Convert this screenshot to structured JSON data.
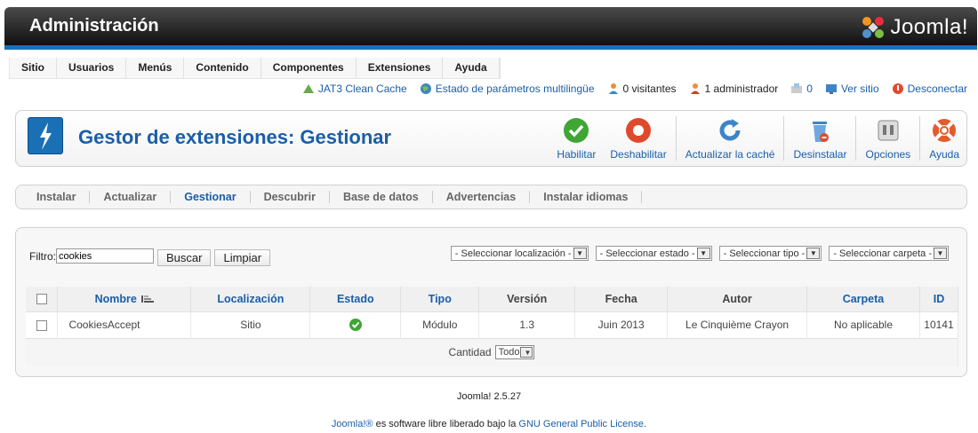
{
  "header": {
    "title": "Administración",
    "logo_text": "Joomla!"
  },
  "menu": [
    "Sitio",
    "Usuarios",
    "Menús",
    "Contenido",
    "Componentes",
    "Extensiones",
    "Ayuda"
  ],
  "status": {
    "cache": "JAT3 Clean Cache",
    "multilang": "Estado de parámetros multilingüe",
    "visitors": "0 visitantes",
    "admins": "1 administrador",
    "messages": "0",
    "view_site": "Ver sitio",
    "logout": "Desconectar"
  },
  "toolbar": {
    "title": "Gestor de extensiones: Gestionar",
    "enable": "Habilitar",
    "disable": "Deshabilitar",
    "refresh": "Actualizar la caché",
    "uninstall": "Desinstalar",
    "options": "Opciones",
    "help": "Ayuda"
  },
  "tabs": [
    "Instalar",
    "Actualizar",
    "Gestionar",
    "Descubrir",
    "Base de datos",
    "Advertencias",
    "Instalar idiomas"
  ],
  "filter": {
    "label": "Filtro:",
    "value": "cookies",
    "search": "Buscar",
    "clear": "Limpiar",
    "location": "- Seleccionar localización -",
    "state": "- Seleccionar estado -",
    "type": "- Seleccionar tipo -",
    "folder": "- Seleccionar carpeta -"
  },
  "table": {
    "headers": [
      "Nombre",
      "Localización",
      "Estado",
      "Tipo",
      "Versión",
      "Fecha",
      "Autor",
      "Carpeta",
      "ID"
    ],
    "rows": [
      {
        "name": "CookiesAccept",
        "location": "Sitio",
        "type": "Módulo",
        "version": "1.3",
        "date": "Juin 2013",
        "author": "Le Cinquième Crayon",
        "folder": "No aplicable",
        "id": "10141"
      }
    ],
    "quantity_label": "Cantidad",
    "quantity_value": "Todo"
  },
  "footer": {
    "version": "Joomla! 2.5.27",
    "brand": "Joomla!®",
    "middle": " es software libre liberado bajo la ",
    "license": "GNU General Public License."
  },
  "colors": {
    "accent": "#1a70b5",
    "link": "#1a5ea8",
    "enable": "#3fa535",
    "disable": "#e04a2c"
  }
}
